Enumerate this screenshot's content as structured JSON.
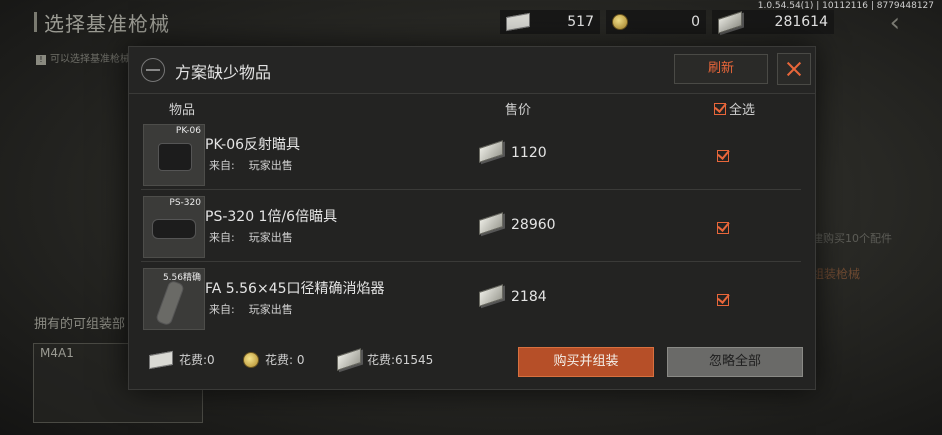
{
  "background": {
    "page_title": "选择基准枪械",
    "hint": "可以选择基准枪械",
    "version": "1.0.54.54(1) | 10112116 | 8779448127",
    "right_text_1": "建购买10个配件",
    "right_text_2": "组装枪械",
    "owned_label": "拥有的可组装部",
    "weapon_card_label": "M4A1"
  },
  "currencies": [
    {
      "icon": "card-icon",
      "value": "517"
    },
    {
      "icon": "coin-icon",
      "value": "0"
    },
    {
      "icon": "money-icon",
      "value": "281614"
    }
  ],
  "dialog": {
    "title": "方案缺少物品",
    "refresh_label": "刷新",
    "columns": {
      "item": "物品",
      "price": "售价",
      "select_all": "全选"
    },
    "items": [
      {
        "tag": "PK-06",
        "name": "PK-06反射瞄具",
        "source_label": "来自:",
        "source": "玩家出售",
        "price": "1120",
        "checked": true
      },
      {
        "tag": "PS-320",
        "name": "PS-320 1倍/6倍瞄具",
        "source_label": "来自:",
        "source": "玩家出售",
        "price": "28960",
        "checked": true
      },
      {
        "tag": "5.56精确",
        "name": "FA 5.56×45口径精确消焰器",
        "source_label": "来自:",
        "source": "玩家出售",
        "price": "2184",
        "checked": true
      }
    ],
    "footer": {
      "cost1": "花费:0",
      "cost2": "花费: 0",
      "cost3": "花费:61545"
    },
    "buy_label": "购买并组装",
    "ignore_label": "忽略全部"
  },
  "colors": {
    "accent": "#e8663a",
    "buy_button": "#b64f28",
    "ignore_button": "#6a6a68"
  }
}
